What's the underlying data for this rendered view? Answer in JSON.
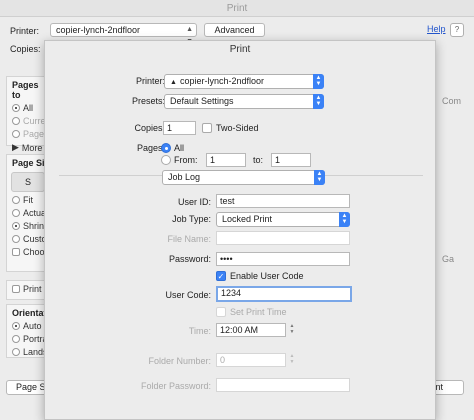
{
  "back": {
    "title": "Print",
    "printer_label": "Printer:",
    "printer_value": "copier-lynch-2ndfloor",
    "advanced_label": "Advanced",
    "help_label": "Help",
    "help_icon": "?",
    "copies_label": "Copies:",
    "pages_section": {
      "heading": "Pages to",
      "items": [
        {
          "label": "All",
          "selected": true
        },
        {
          "label": "Current",
          "dim": true
        },
        {
          "label": "Pages",
          "dim": true
        },
        {
          "label": "More"
        }
      ]
    },
    "size_section": {
      "heading": "Page Siz",
      "button_label": "S",
      "items": [
        {
          "label": "Fit"
        },
        {
          "label": "Actual"
        },
        {
          "label": "Shrink",
          "selected": true
        },
        {
          "label": "Custom"
        },
        {
          "label": "Choose"
        }
      ]
    },
    "print_on_label": "Print o",
    "orientation": {
      "heading": "Orientatio",
      "items": [
        {
          "label": "Auto",
          "selected": true
        },
        {
          "label": "Portra"
        },
        {
          "label": "Lands"
        }
      ]
    },
    "page_setup_label": "Page Se",
    "print_button_label": "int",
    "right_fragments": [
      "Com",
      "Ga"
    ]
  },
  "sheet": {
    "title": "Print",
    "printer_label": "Printer:",
    "printer_value": "copier-lynch-2ndfloor",
    "printer_warning_icon": "▲",
    "presets_label": "Presets:",
    "presets_value": "Default Settings",
    "copies_label": "Copies:",
    "copies_value": "1",
    "two_sided_label": "Two-Sided",
    "pages_label": "Pages:",
    "pages_all_label": "All",
    "pages_from_label": "From:",
    "pages_from_value": "1",
    "pages_to_label": "to:",
    "pages_to_value": "1",
    "panel_value": "Job Log",
    "user_id_label": "User ID:",
    "user_id_value": "test",
    "job_type_label": "Job Type:",
    "job_type_value": "Locked Print",
    "file_name_label": "File Name:",
    "file_name_value": "",
    "password_label": "Password:",
    "password_value": "••••",
    "enable_user_code_label": "Enable User Code",
    "user_code_label": "User Code:",
    "user_code_value": "1234",
    "set_print_time_label": "Set Print Time",
    "time_label": "Time:",
    "time_value": "12:00 AM",
    "folder_number_label": "Folder Number:",
    "folder_number_value": "0",
    "folder_password_label": "Folder Password:",
    "folder_password_value": ""
  },
  "colors": {
    "accent": "#3b82f6",
    "link": "#2255cc"
  }
}
